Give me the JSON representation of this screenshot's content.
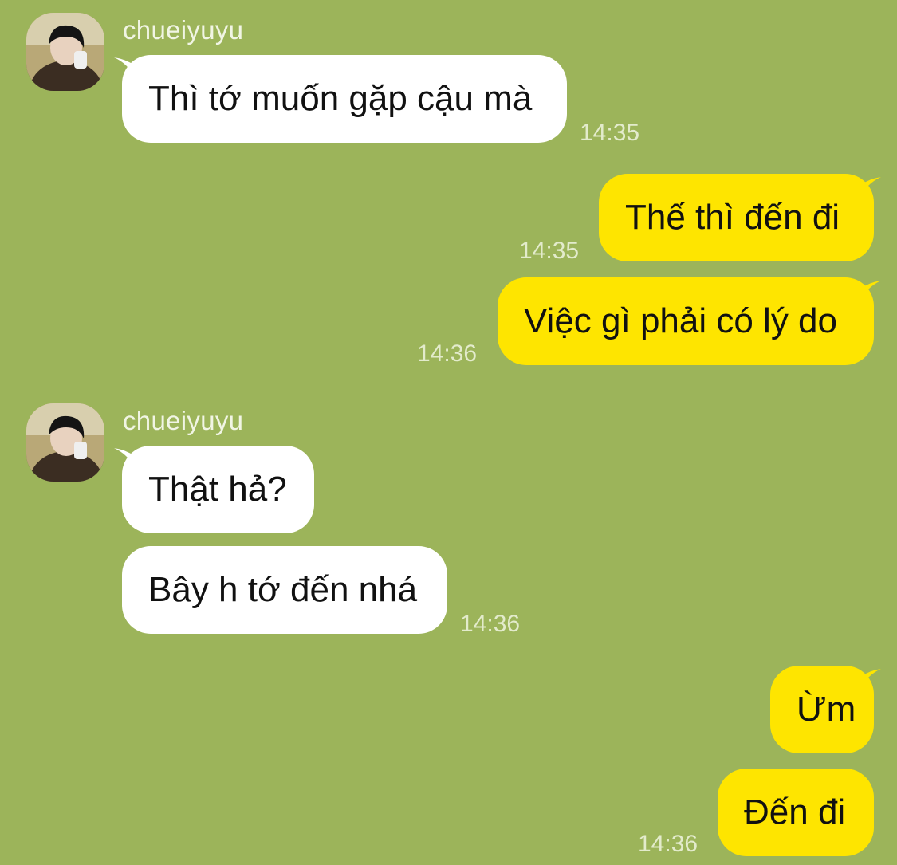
{
  "contact": {
    "name": "chueiyuyu"
  },
  "messages": [
    {
      "from": "contact",
      "text": "Thì tớ muốn gặp cậu mà",
      "time": "14:35"
    },
    {
      "from": "me",
      "text": "Thế thì đến đi",
      "time": "14:35"
    },
    {
      "from": "me",
      "text": "Việc gì phải có lý do",
      "time": "14:36"
    },
    {
      "from": "contact",
      "text": "Thật hả?",
      "time": ""
    },
    {
      "from": "contact",
      "text": "Bây h tớ đến nhá",
      "time": "14:36"
    },
    {
      "from": "me",
      "text": "Ừm",
      "time": ""
    },
    {
      "from": "me",
      "text": "Đến đi",
      "time": "14:36"
    }
  ],
  "colors": {
    "background": "#9cb45a",
    "incoming_bubble": "#ffffff",
    "outgoing_bubble": "#fee500"
  },
  "icons": {
    "avatar": "profile-photo"
  }
}
